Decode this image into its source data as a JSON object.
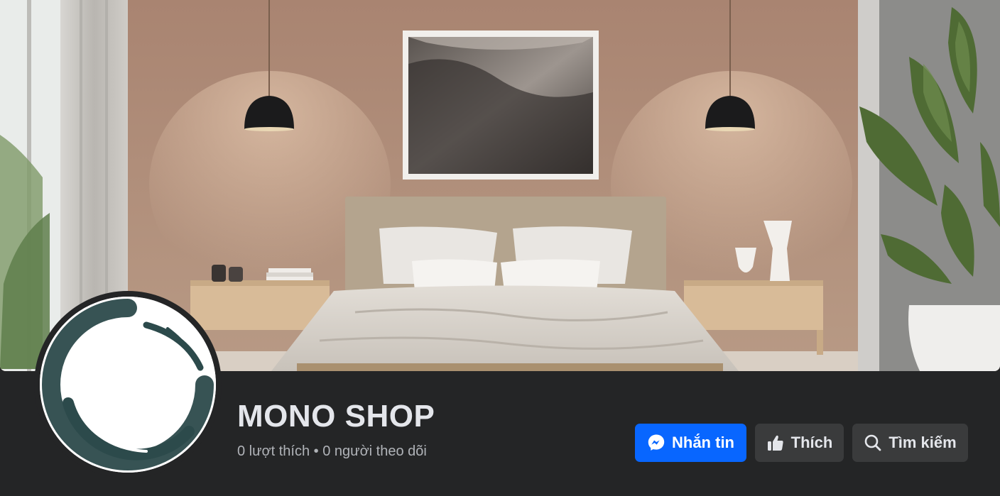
{
  "page": {
    "name": "MONO SHOP",
    "likes_label": "0 lượt thích",
    "separator": "•",
    "followers_label": "0 người theo dõi"
  },
  "actions": {
    "message": {
      "label": "Nhắn tin",
      "icon": "messenger-icon"
    },
    "like": {
      "label": "Thích",
      "icon": "thumbs-up-icon"
    },
    "search": {
      "label": "Tìm kiếm",
      "icon": "search-icon"
    }
  },
  "cover": {
    "description_icon": "bedroom-cover-photo"
  },
  "colors": {
    "background": "#242526",
    "primary": "#0866ff",
    "secondary_button": "#3a3b3c",
    "text_primary": "#e4e6eb",
    "text_secondary": "#b0b3b8"
  }
}
